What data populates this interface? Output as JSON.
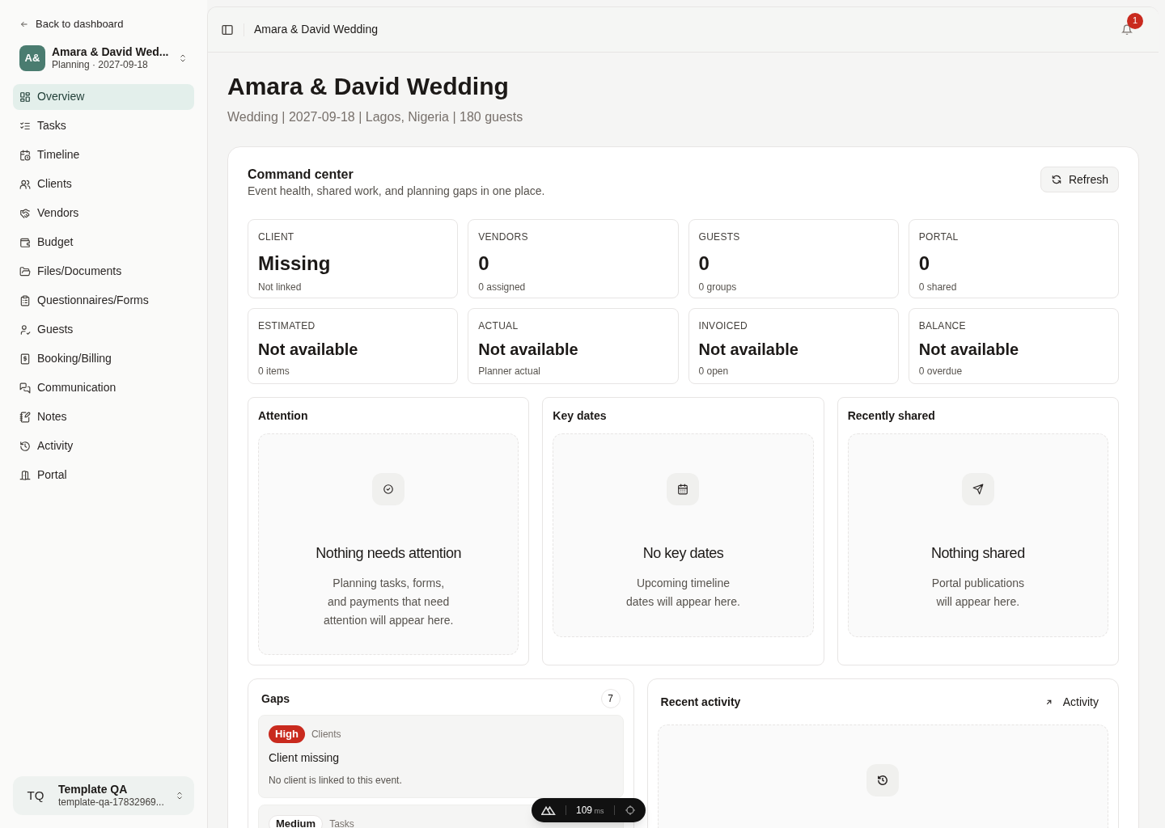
{
  "sidebar": {
    "back_link": "Back to dashboard",
    "event": {
      "initials": "A&",
      "name": "Amara & David Wed...",
      "meta": "Planning · 2027-09-18"
    },
    "items": [
      {
        "label": "Overview",
        "selected": true
      },
      {
        "label": "Tasks",
        "selected": false
      },
      {
        "label": "Timeline",
        "selected": false
      },
      {
        "label": "Clients",
        "selected": false
      },
      {
        "label": "Vendors",
        "selected": false
      },
      {
        "label": "Budget",
        "selected": false
      },
      {
        "label": "Files/Documents",
        "selected": false
      },
      {
        "label": "Questionnaires/Forms",
        "selected": false
      },
      {
        "label": "Guests",
        "selected": false
      },
      {
        "label": "Booking/Billing",
        "selected": false
      },
      {
        "label": "Communication",
        "selected": false
      },
      {
        "label": "Notes",
        "selected": false
      },
      {
        "label": "Activity",
        "selected": false
      },
      {
        "label": "Portal",
        "selected": false
      }
    ],
    "workspace": {
      "initials": "TQ",
      "name": "Template QA",
      "slug": "template-qa-17832969..."
    }
  },
  "header": {
    "breadcrumb": "Amara & David Wedding",
    "notification_count": "1"
  },
  "page": {
    "title": "Amara & David Wedding",
    "subtitle": "Wedding | 2027-09-18 | Lagos, Nigeria | 180 guests"
  },
  "command_center": {
    "title": "Command center",
    "description": "Event health, shared work, and planning gaps in one place.",
    "refresh_button": "Refresh",
    "stats": [
      {
        "label": "CLIENT",
        "value": "Missing",
        "note": "Not linked"
      },
      {
        "label": "VENDORS",
        "value": "0",
        "note": "0 assigned"
      },
      {
        "label": "GUESTS",
        "value": "0",
        "note": "0 groups"
      },
      {
        "label": "PORTAL",
        "value": "0",
        "note": "0 shared"
      },
      {
        "label": "ESTIMATED",
        "value": "Not available",
        "note": "0 items"
      },
      {
        "label": "ACTUAL",
        "value": "Not available",
        "note": "Planner actual"
      },
      {
        "label": "INVOICED",
        "value": "Not available",
        "note": "0 open"
      },
      {
        "label": "BALANCE",
        "value": "Not available",
        "note": "0 overdue"
      }
    ],
    "panels": [
      {
        "title": "Attention",
        "empty_title": "Nothing needs attention",
        "empty_text": "Planning tasks, forms,\nand payments that need\nattention will appear here."
      },
      {
        "title": "Key dates",
        "empty_title": "No key dates",
        "empty_text": "Upcoming timeline\ndates will appear here."
      },
      {
        "title": "Recently shared",
        "empty_title": "Nothing shared",
        "empty_text": "Portal publications\nwill appear here."
      }
    ],
    "gaps": {
      "title": "Gaps",
      "count": "7",
      "items": [
        {
          "severity": "High",
          "color": "#c92a1e",
          "area": "Clients",
          "title": "Client missing",
          "text": "No client is linked to this event."
        },
        {
          "severity": "Medium",
          "area": "Tasks"
        }
      ]
    },
    "recent_activity": {
      "title": "Recent activity",
      "link": "Activity"
    }
  },
  "devtools": {
    "value": "109",
    "unit": "ms"
  }
}
